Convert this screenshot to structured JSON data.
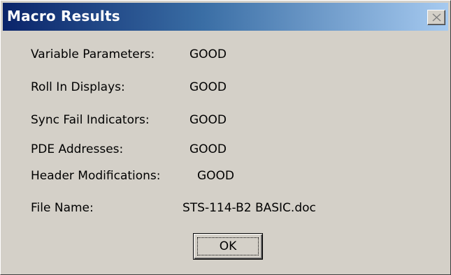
{
  "dialog": {
    "title": "Macro Results",
    "close_icon": "close-icon"
  },
  "results": [
    {
      "label": "Variable Parameters:",
      "value": "GOOD"
    },
    {
      "label": "Roll In Displays:",
      "value": "GOOD"
    },
    {
      "label": "Sync Fail Indicators:",
      "value": "GOOD"
    },
    {
      "label": "PDE Addresses:",
      "value": "GOOD"
    },
    {
      "label": "Header Modifications:",
      "value": "GOOD"
    },
    {
      "label": "File Name:",
      "value": "STS-114-B2 BASIC.doc"
    }
  ],
  "buttons": {
    "ok_label": "OK"
  },
  "colors": {
    "titlebar_start": "#0a246a",
    "titlebar_end": "#a6caf0",
    "dialog_face": "#d4d0c8"
  }
}
